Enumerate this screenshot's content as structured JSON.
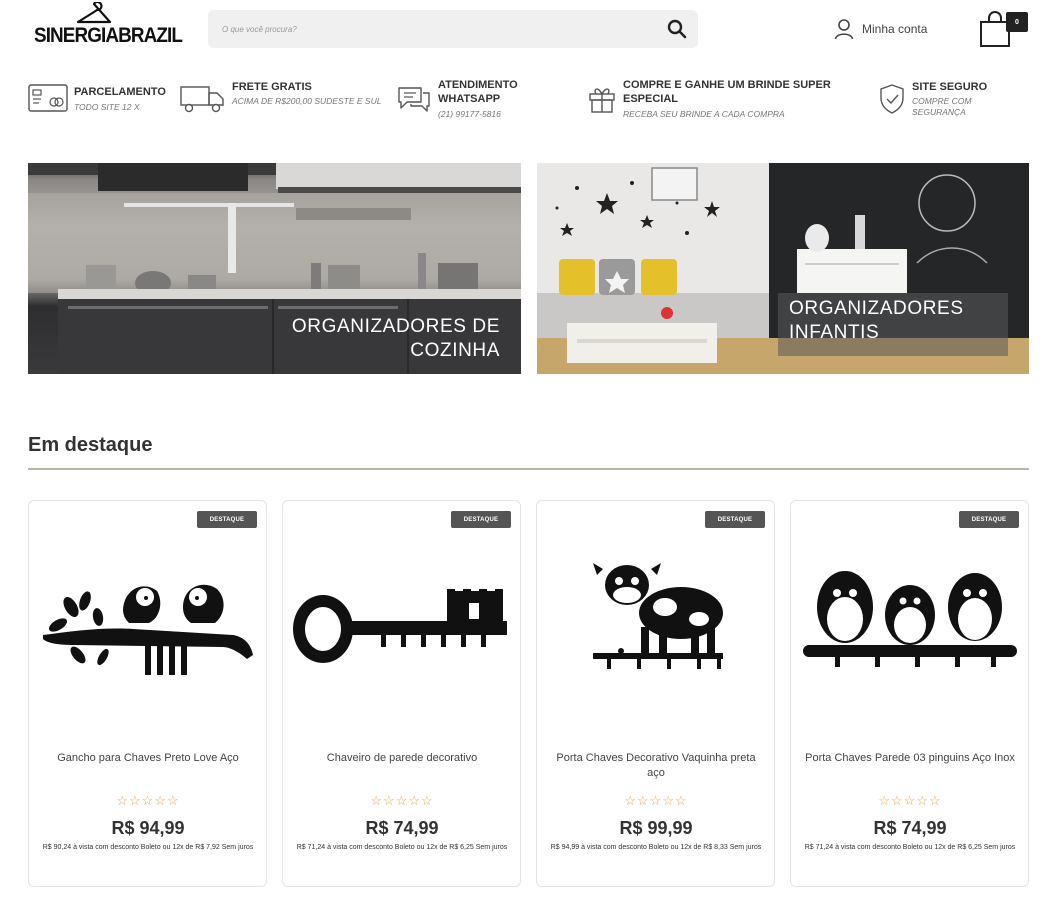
{
  "header": {
    "logo_text": "SINERGIABRAZIL",
    "search_placeholder": "O que você procura?",
    "account_label": "Minha conta",
    "cart_count": "0"
  },
  "benefits": [
    {
      "title": "PARCELAMENTO",
      "subtitle": "TODO SITE 12 x",
      "icon": "credit-card-icon"
    },
    {
      "title": "FRETE GRATIS",
      "subtitle": "ACIMA DE R$200,00 SUDESTE E SUL",
      "icon": "truck-icon"
    },
    {
      "title": "ATENDIMENTO WHATSAPP",
      "subtitle": "(21) 99177-5816",
      "icon": "chat-icon"
    },
    {
      "title": "COMPRE E GANHE UM BRINDE SUPER ESPECIAL",
      "subtitle": "RECEBA SEU BRINDE A CADA COMPRA",
      "icon": "gift-icon"
    },
    {
      "title": "SITE SEGURO",
      "subtitle": "COMPRE COM SEGURANÇA",
      "icon": "shield-icon"
    }
  ],
  "banners": [
    {
      "line1": "ORGANIZADORES DE",
      "line2": "COZINHA"
    },
    {
      "line1": "ORGANIZADORES",
      "line2": "INFANTIS"
    }
  ],
  "section_title": "Em destaque",
  "products": [
    {
      "badge": "DESTAQUE",
      "name": "Gancho para Chaves Preto Love Aço",
      "stars": "☆☆☆☆☆",
      "price": "R$ 94,99",
      "info": "R$ 90,24 à vista com desconto Boleto ou 12x de R$ 7,92 Sem juros"
    },
    {
      "badge": "DESTAQUE",
      "name": "Chaveiro de parede decorativo",
      "stars": "☆☆☆☆☆",
      "price": "R$ 74,99",
      "info": "R$ 71,24 à vista com desconto Boleto ou 12x de R$ 6,25 Sem juros"
    },
    {
      "badge": "DESTAQUE",
      "name": "Porta Chaves Decorativo Vaquinha preta aço",
      "stars": "☆☆☆☆☆",
      "price": "R$ 99,99",
      "info": "R$ 94,99 à vista com desconto Boleto ou 12x de R$ 8,33 Sem juros"
    },
    {
      "badge": "DESTAQUE",
      "name": "Porta Chaves Parede 03 pinguins Aço Inox",
      "stars": "☆☆☆☆☆",
      "price": "R$ 74,99",
      "info": "R$ 71,24 à vista com desconto Boleto ou 12x de R$ 6,25 Sem juros"
    }
  ],
  "colors": {
    "star": "#e8a33b",
    "badge": "#555555",
    "rule": "#b9b6a6",
    "search_bg": "#f0f0f0"
  }
}
